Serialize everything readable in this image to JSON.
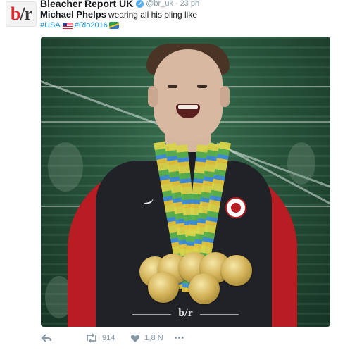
{
  "account": {
    "avatar_text_b": "b",
    "avatar_text_slash": "/",
    "avatar_text_r": "r",
    "display_name": "Bleacher Report UK",
    "handle": "@br_uk",
    "separator": "·",
    "time": "23 ph"
  },
  "tweet": {
    "mention": "Michael Phelps",
    "text": "wearing all his bling like",
    "hashtag_usa": "#USA",
    "hashtag_rio": "#Rio2016"
  },
  "media": {
    "watermark": "b/r"
  },
  "actions": {
    "retweets": "914",
    "likes": "1,8 N",
    "more": "•••"
  },
  "colors": {
    "link": "#1b95e0",
    "muted": "#8899a6",
    "verified": "#55acee"
  }
}
